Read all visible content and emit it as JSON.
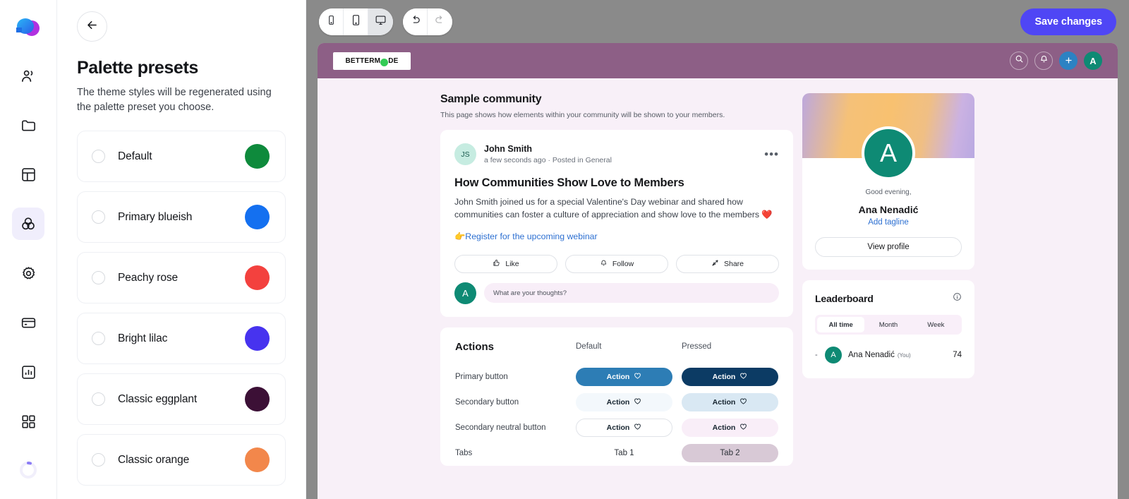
{
  "rail": {
    "logo_icon": "bettermode-cloud-logo",
    "items": [
      {
        "icon": "members-icon",
        "name": "rail-item-members",
        "active": false
      },
      {
        "icon": "folder-icon",
        "name": "rail-item-content",
        "active": false
      },
      {
        "icon": "layout-icon",
        "name": "rail-item-layout",
        "active": false
      },
      {
        "icon": "theme-circles-icon",
        "name": "rail-item-appearance",
        "active": true
      },
      {
        "icon": "gear-icon",
        "name": "rail-item-settings",
        "active": false
      },
      {
        "icon": "card-icon",
        "name": "rail-item-billing",
        "active": false
      },
      {
        "icon": "chart-icon",
        "name": "rail-item-analytics",
        "active": false
      },
      {
        "icon": "apps-grid-icon",
        "name": "rail-item-apps",
        "active": false
      }
    ],
    "spinner_icon": "loading-spinner-icon"
  },
  "panel": {
    "back_icon": "arrow-left-icon",
    "title": "Palette presets",
    "subtitle": "The theme styles will be regenerated using the palette preset you choose.",
    "presets": [
      {
        "label": "Default",
        "color": "#0e8a3c",
        "selected": false
      },
      {
        "label": "Primary blueish",
        "color": "#1470f0",
        "selected": false
      },
      {
        "label": "Peachy rose",
        "color": "#f3413e",
        "selected": false
      },
      {
        "label": "Bright lilac",
        "color": "#4733ef",
        "selected": false
      },
      {
        "label": "Classic eggplant",
        "color": "#3c1036",
        "selected": false
      },
      {
        "label": "Classic orange",
        "color": "#f2874b",
        "selected": false
      }
    ]
  },
  "toolbar": {
    "devices": [
      {
        "name": "device-mobile",
        "icon": "mobile-icon",
        "active": false
      },
      {
        "name": "device-tablet",
        "icon": "tablet-icon",
        "active": false
      },
      {
        "name": "device-desktop",
        "icon": "desktop-icon",
        "active": true
      }
    ],
    "undo_icon": "undo-icon",
    "redo_icon": "redo-icon",
    "save_label": "Save changes",
    "save_color": "#4f46f5"
  },
  "site": {
    "header": {
      "brand_name": "BETTERM",
      "brand_name_end": "DE",
      "search_icon": "search-icon",
      "notification_icon": "bell-icon",
      "add_icon": "plus-icon",
      "avatar_initial": "A"
    },
    "community": {
      "title": "Sample community",
      "subtitle": "This page shows how elements within your community will be shown to your members."
    },
    "post": {
      "avatar_initials": "JS",
      "author": "John Smith",
      "meta": "a few seconds ago · Posted in General",
      "more_icon": "more-horizontal-icon",
      "title": "How Communities Show Love to Members",
      "body": "John Smith joined us for a special Valentine's Day webinar and shared how communities can foster a culture of appreciation and show love to the members ❤️",
      "link": "👉Register for the upcoming webinar",
      "actions": [
        {
          "label": "Like",
          "icon": "thumbs-up-icon"
        },
        {
          "label": "Follow",
          "icon": "bell-icon"
        },
        {
          "label": "Share",
          "icon": "share-icon"
        }
      ],
      "comment_avatar": "A",
      "comment_placeholder": "What are your thoughts?"
    },
    "actions_section": {
      "title": "Actions",
      "col_default": "Default",
      "col_pressed": "Pressed",
      "rows": [
        {
          "label": "Primary button",
          "default_text": "Action",
          "pressed_text": "Action"
        },
        {
          "label": "Secondary button",
          "default_text": "Action",
          "pressed_text": "Action"
        },
        {
          "label": "Secondary neutral button",
          "default_text": "Action",
          "pressed_text": "Action"
        },
        {
          "label": "Tabs",
          "default_text": "Tab 1",
          "pressed_text": "Tab 2"
        }
      ]
    },
    "profile": {
      "avatar_initial": "A",
      "greeting": "Good evening,",
      "name": "Ana Nenadić",
      "tagline": "Add tagline",
      "view_profile": "View profile"
    },
    "leaderboard": {
      "title": "Leaderboard",
      "info_icon": "info-icon",
      "tabs": [
        {
          "label": "All time",
          "active": true
        },
        {
          "label": "Month",
          "active": false
        },
        {
          "label": "Week",
          "active": false
        }
      ],
      "rows": [
        {
          "rank": "-",
          "avatar": "A",
          "name": "Ana Nenadić",
          "you": "(You)",
          "score": "74"
        }
      ]
    }
  }
}
